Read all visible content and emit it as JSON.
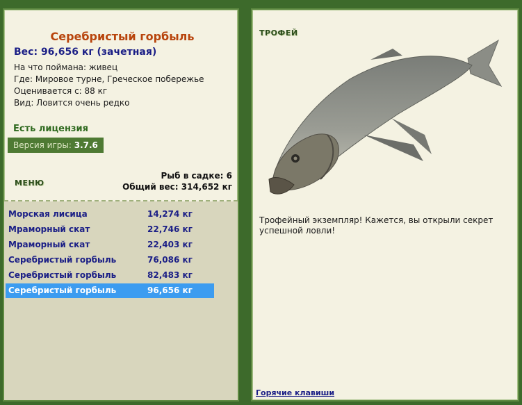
{
  "catch": {
    "fish_name": "Серебристый горбыль",
    "weight_line": "Вес: 96,656 кг (зачетная)",
    "bait": "На что поймана: живец",
    "location": "Где: Мировое турне, Греческое побережье",
    "valued": "Оценивается с: 88 кг",
    "rarity": "Вид: Ловится очень редко"
  },
  "license": "Есть лицензия",
  "version": {
    "label": "Версия игры:",
    "value": "3.7.6"
  },
  "menu": {
    "label": "МЕНЮ"
  },
  "keepnet": {
    "count_line": "Рыб в садке: 6",
    "total_line": "Общий вес: 314,652 кг"
  },
  "fish_list": [
    {
      "name": "Морская лисица",
      "weight": "14,274 кг"
    },
    {
      "name": "Мраморный скат",
      "weight": "22,746 кг"
    },
    {
      "name": "Мраморный скат",
      "weight": "22,403 кг"
    },
    {
      "name": "Серебристый горбыль",
      "weight": "76,086 кг"
    },
    {
      "name": "Серебристый горбыль",
      "weight": "82,483 кг"
    },
    {
      "name": "Серебристый горбыль",
      "weight": "96,656 кг"
    }
  ],
  "selected_index": 5,
  "trophy": {
    "heading": "ТРОФЕЙ",
    "text": "Трофейный экземпляр! Кажется, вы открыли секрет успешной ловли!"
  },
  "hotkeys": "Горячие клавиши",
  "colors": {
    "background": "#3d6a2b",
    "panel": "#f4f2e2",
    "fish_name": "#b8440c",
    "link": "#1b1f86",
    "selection": "#3c9cf0",
    "list_bg": "#d8d6bd"
  }
}
